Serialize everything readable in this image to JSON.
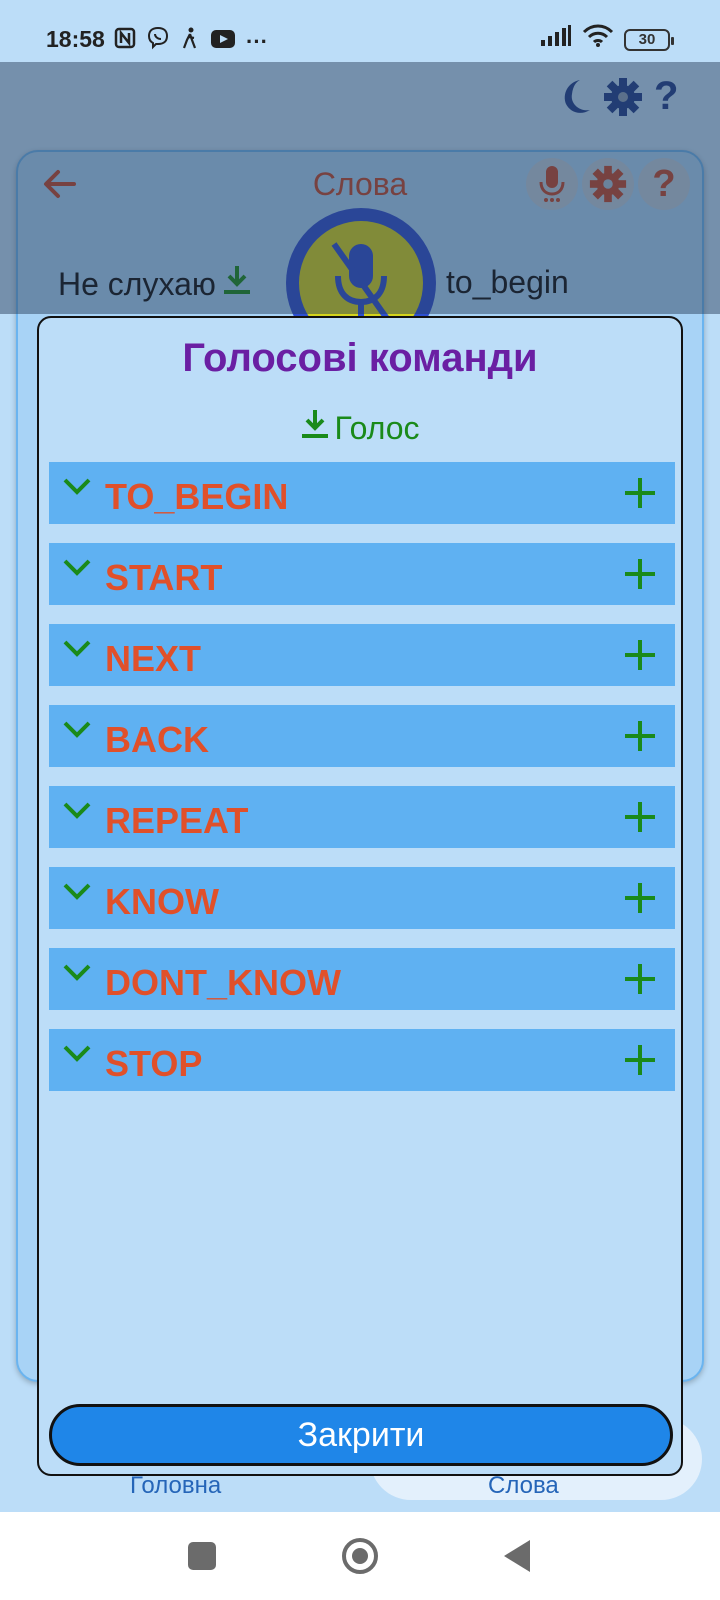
{
  "status_bar": {
    "time": "18:58",
    "battery": "30",
    "more": "···"
  },
  "top_toolbar": {
    "icons": [
      "moon-icon",
      "gear-icon",
      "help-icon"
    ],
    "accent": "#1d3f8c"
  },
  "words_screen": {
    "title": "Слова",
    "listen_status": "Не слухаю",
    "current_command": "to_begin",
    "header_icons": [
      "microphone-icon",
      "gear-icon",
      "help-icon"
    ]
  },
  "dialog": {
    "title": "Голосові команди",
    "voice_link": "Голос",
    "commands": [
      {
        "label": "TO_BEGIN"
      },
      {
        "label": "START"
      },
      {
        "label": "NEXT"
      },
      {
        "label": "BACK"
      },
      {
        "label": "REPEAT"
      },
      {
        "label": "KNOW"
      },
      {
        "label": "DONT_KNOW"
      },
      {
        "label": "STOP"
      }
    ],
    "close_label": "Закрити",
    "colors": {
      "title": "#6a1fa3",
      "command_text": "#e0502a",
      "command_bg": "#5fb1f2",
      "green": "#1a8a1a",
      "close_bg": "#1f86e8"
    }
  },
  "bottom_nav": {
    "items": [
      {
        "label": "Головна"
      },
      {
        "label": "Слова"
      }
    ]
  }
}
